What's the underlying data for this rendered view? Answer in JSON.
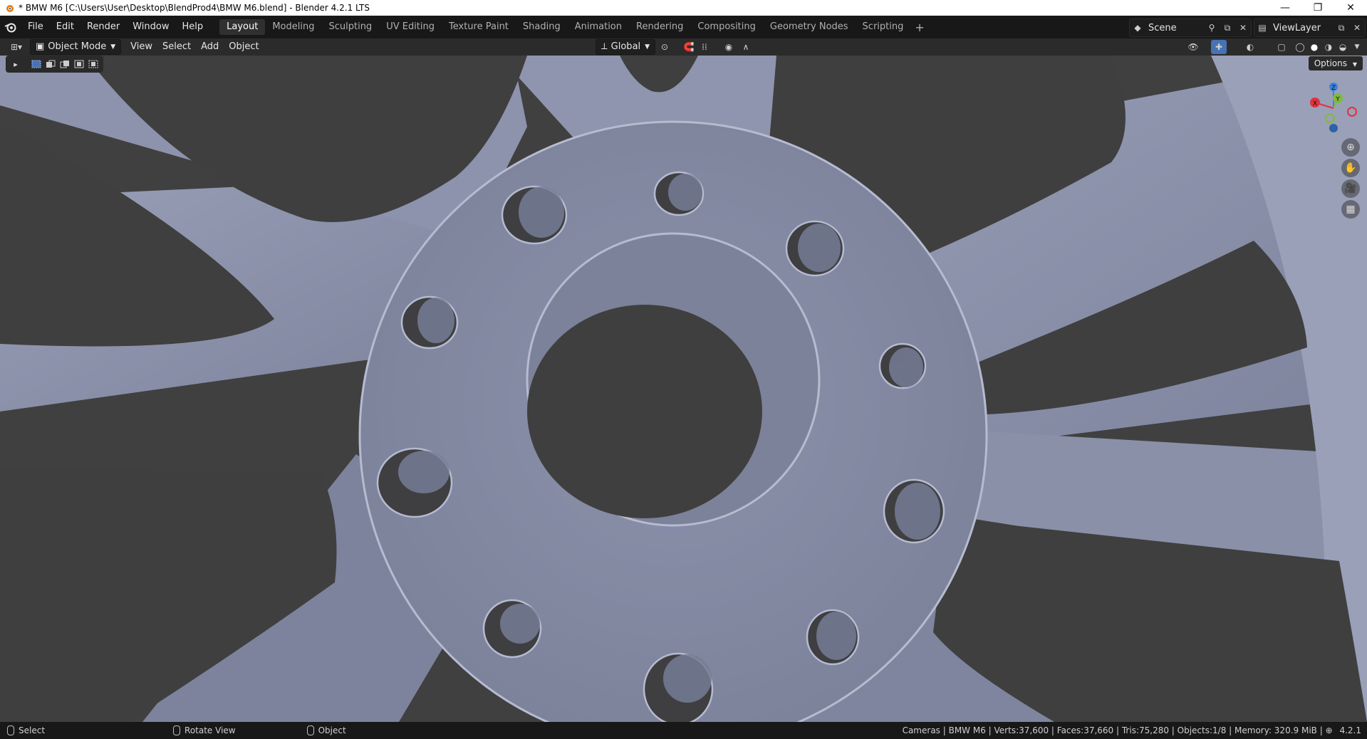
{
  "window": {
    "title": "* BMW M6 [C:\\Users\\User\\Desktop\\BlendProd4\\BMW M6.blend] - Blender 4.2.1 LTS",
    "minimize": "—",
    "maximize": "❐",
    "close": "✕"
  },
  "menu": {
    "items": [
      "File",
      "Edit",
      "Render",
      "Window",
      "Help"
    ]
  },
  "workspaces": {
    "tabs": [
      "Layout",
      "Modeling",
      "Sculpting",
      "UV Editing",
      "Texture Paint",
      "Shading",
      "Animation",
      "Rendering",
      "Compositing",
      "Geometry Nodes",
      "Scripting"
    ],
    "active": "Layout",
    "add": "+"
  },
  "scene": {
    "name": "Scene"
  },
  "view_layer": {
    "name": "ViewLayer"
  },
  "viewport_header": {
    "mode": "Object Mode",
    "menus": [
      "View",
      "Select",
      "Add",
      "Object"
    ],
    "orientation": "Global"
  },
  "viewport": {
    "options_label": "Options",
    "gizmo_axes": {
      "x": "X",
      "y": "Y",
      "z": "Z"
    },
    "colors": {
      "x": "#e0323e",
      "y": "#7fba3c",
      "z": "#3b82dc",
      "object": "#8a90a8",
      "background": "#404040"
    }
  },
  "statusbar": {
    "select": "Select",
    "rotate": "Rotate View",
    "object": "Object",
    "stats": "Cameras | BMW M6 | Verts:37,600 | Faces:37,660 | Tris:75,280 | Objects:1/8 | Memory: 320.9 MiB | ",
    "version": "4.2.1"
  }
}
